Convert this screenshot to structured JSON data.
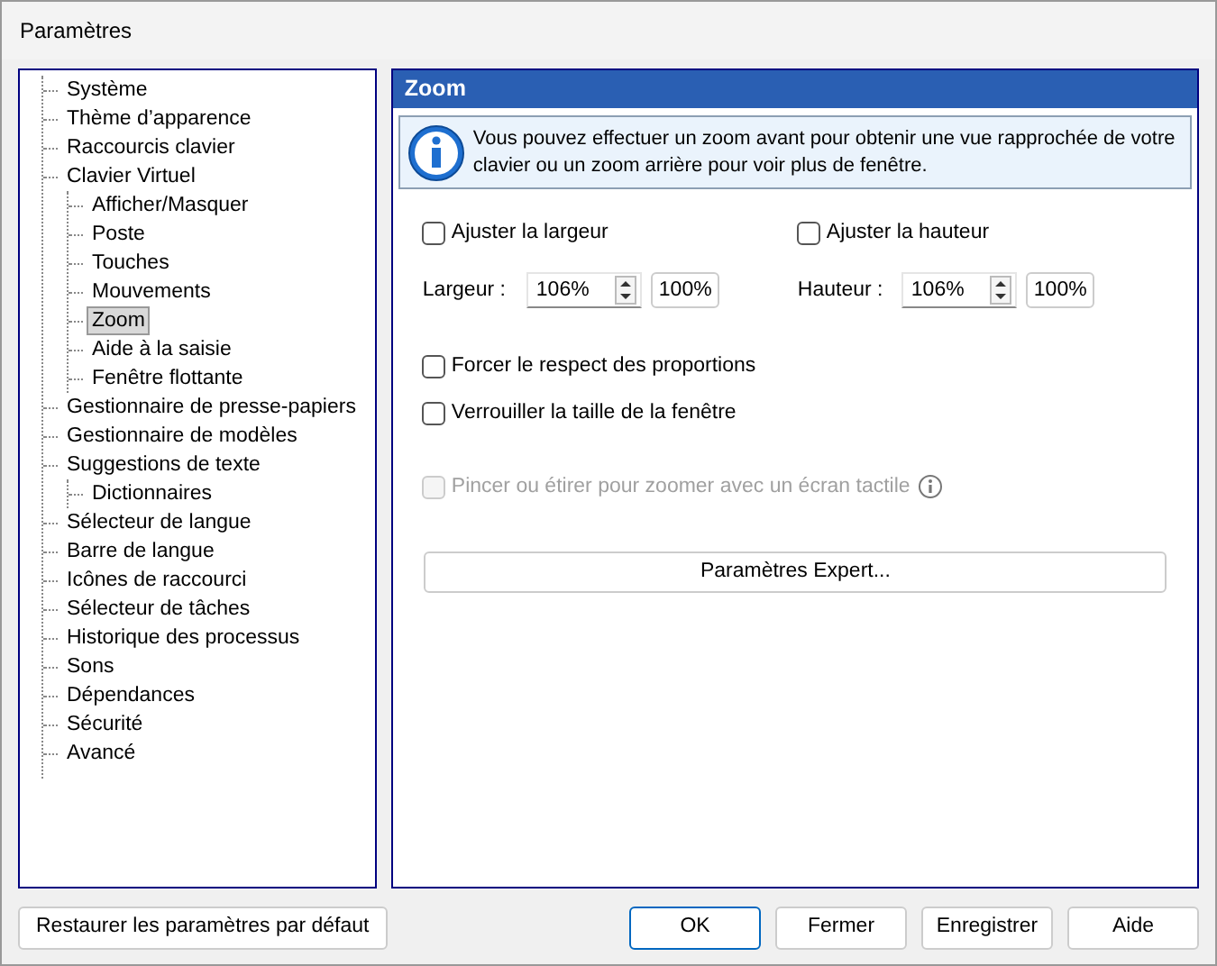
{
  "window": {
    "title": "Paramètres"
  },
  "tree": [
    {
      "label": "Système",
      "selected": false
    },
    {
      "label": "Thème d’apparence",
      "selected": false
    },
    {
      "label": "Raccourcis clavier",
      "selected": false
    },
    {
      "label": "Clavier Virtuel",
      "selected": false,
      "children": [
        {
          "label": "Afficher/Masquer",
          "selected": false
        },
        {
          "label": "Poste",
          "selected": false
        },
        {
          "label": "Touches",
          "selected": false
        },
        {
          "label": "Mouvements",
          "selected": false
        },
        {
          "label": "Zoom",
          "selected": true
        },
        {
          "label": "Aide à la saisie",
          "selected": false
        },
        {
          "label": "Fenêtre flottante",
          "selected": false
        }
      ]
    },
    {
      "label": "Gestionnaire de presse-papiers",
      "selected": false
    },
    {
      "label": "Gestionnaire de modèles",
      "selected": false
    },
    {
      "label": "Suggestions de texte",
      "selected": false,
      "children": [
        {
          "label": "Dictionnaires",
          "selected": false
        }
      ]
    },
    {
      "label": "Sélecteur de langue",
      "selected": false
    },
    {
      "label": "Barre de langue",
      "selected": false
    },
    {
      "label": "Icônes de raccourci",
      "selected": false
    },
    {
      "label": "Sélecteur de tâches",
      "selected": false
    },
    {
      "label": "Historique des processus",
      "selected": false
    },
    {
      "label": "Sons",
      "selected": false
    },
    {
      "label": "Dépendances",
      "selected": false
    },
    {
      "label": "Sécurité",
      "selected": false
    },
    {
      "label": "Avancé",
      "selected": false
    }
  ],
  "panel": {
    "title": "Zoom",
    "info": "Vous pouvez effectuer un zoom avant pour obtenir une vue rapprochée de votre clavier ou un zoom arrière pour voir plus de fenêtre.",
    "fit": [
      {
        "label": "Ajuster la largeur",
        "checked": false
      },
      {
        "label": "Ajuster la hauteur",
        "checked": false
      }
    ],
    "spinners": [
      {
        "label": "Largeur :",
        "value": "106%",
        "reset": "100%"
      },
      {
        "label": "Hauteur :",
        "value": "106%",
        "reset": "100%"
      }
    ],
    "options": [
      {
        "label": "Forcer le respect des proportions",
        "checked": false,
        "disabled": false
      },
      {
        "label": "Verrouiller la taille de la fenêtre",
        "checked": false,
        "disabled": false
      }
    ],
    "touch": {
      "label": "Pincer ou étirer pour zoomer avec un écran tactile",
      "checked": false,
      "disabled": true
    },
    "expert_button": "Paramètres Expert..."
  },
  "restore_button": "Restaurer les paramètres par défaut",
  "buttons": [
    {
      "label": "OK",
      "default": true
    },
    {
      "label": "Fermer",
      "default": false
    },
    {
      "label": "Enregistrer",
      "default": false
    },
    {
      "label": "Aide",
      "default": false
    }
  ]
}
